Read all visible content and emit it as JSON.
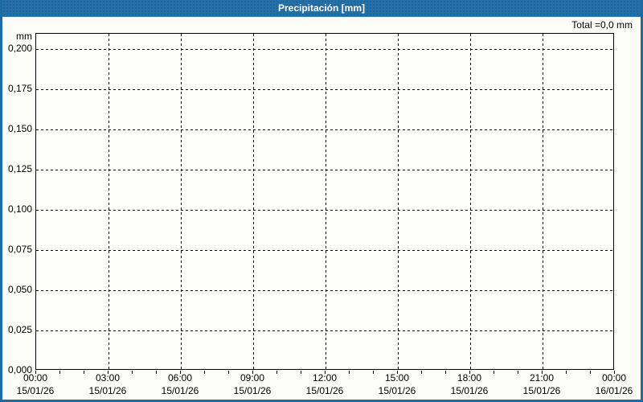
{
  "window": {
    "title": "Precipitación [mm]"
  },
  "summary": {
    "total_label": "Total =0,0 mm",
    "total_value_mm": 0.0
  },
  "colors": {
    "frame_blue": "#1e6ba4",
    "title_text": "#ffffff",
    "page_background": "#fdfdf8",
    "plot_border": "#000000",
    "grid": "#000000",
    "label_text": "#000000"
  },
  "chart_data": {
    "type": "bar",
    "title": "Precipitación [mm]",
    "ylabel": "mm",
    "xlabel": "",
    "total_label": "Total =0,0 mm",
    "ylim": [
      0.0,
      0.2095
    ],
    "y_tick_values": [
      0.2,
      0.175,
      0.15,
      0.125,
      0.1,
      0.075,
      0.05,
      0.025,
      0.0
    ],
    "y_tick_labels": [
      "0,200",
      "0,175",
      "0,150",
      "0,125",
      "0,100",
      "0,075",
      "0,050",
      "0,025",
      "0,000"
    ],
    "x_ticks": [
      {
        "time": "00:00",
        "date": "15/01/26"
      },
      {
        "time": "03:00",
        "date": "15/01/26"
      },
      {
        "time": "06:00",
        "date": "15/01/26"
      },
      {
        "time": "09:00",
        "date": "15/01/26"
      },
      {
        "time": "12:00",
        "date": "15/01/26"
      },
      {
        "time": "15:00",
        "date": "15/01/26"
      },
      {
        "time": "18:00",
        "date": "15/01/26"
      },
      {
        "time": "21:00",
        "date": "15/01/26"
      },
      {
        "time": "00:00",
        "date": "16/01/26"
      }
    ],
    "x_major_tick_interval_hours": 3,
    "x_minor_tick_interval_hours": 1,
    "x_range_hours": 24,
    "grid": "dashed",
    "legend": "none",
    "series": [
      {
        "name": "Precipitación",
        "unit": "mm",
        "values": [],
        "total": 0.0
      }
    ]
  }
}
